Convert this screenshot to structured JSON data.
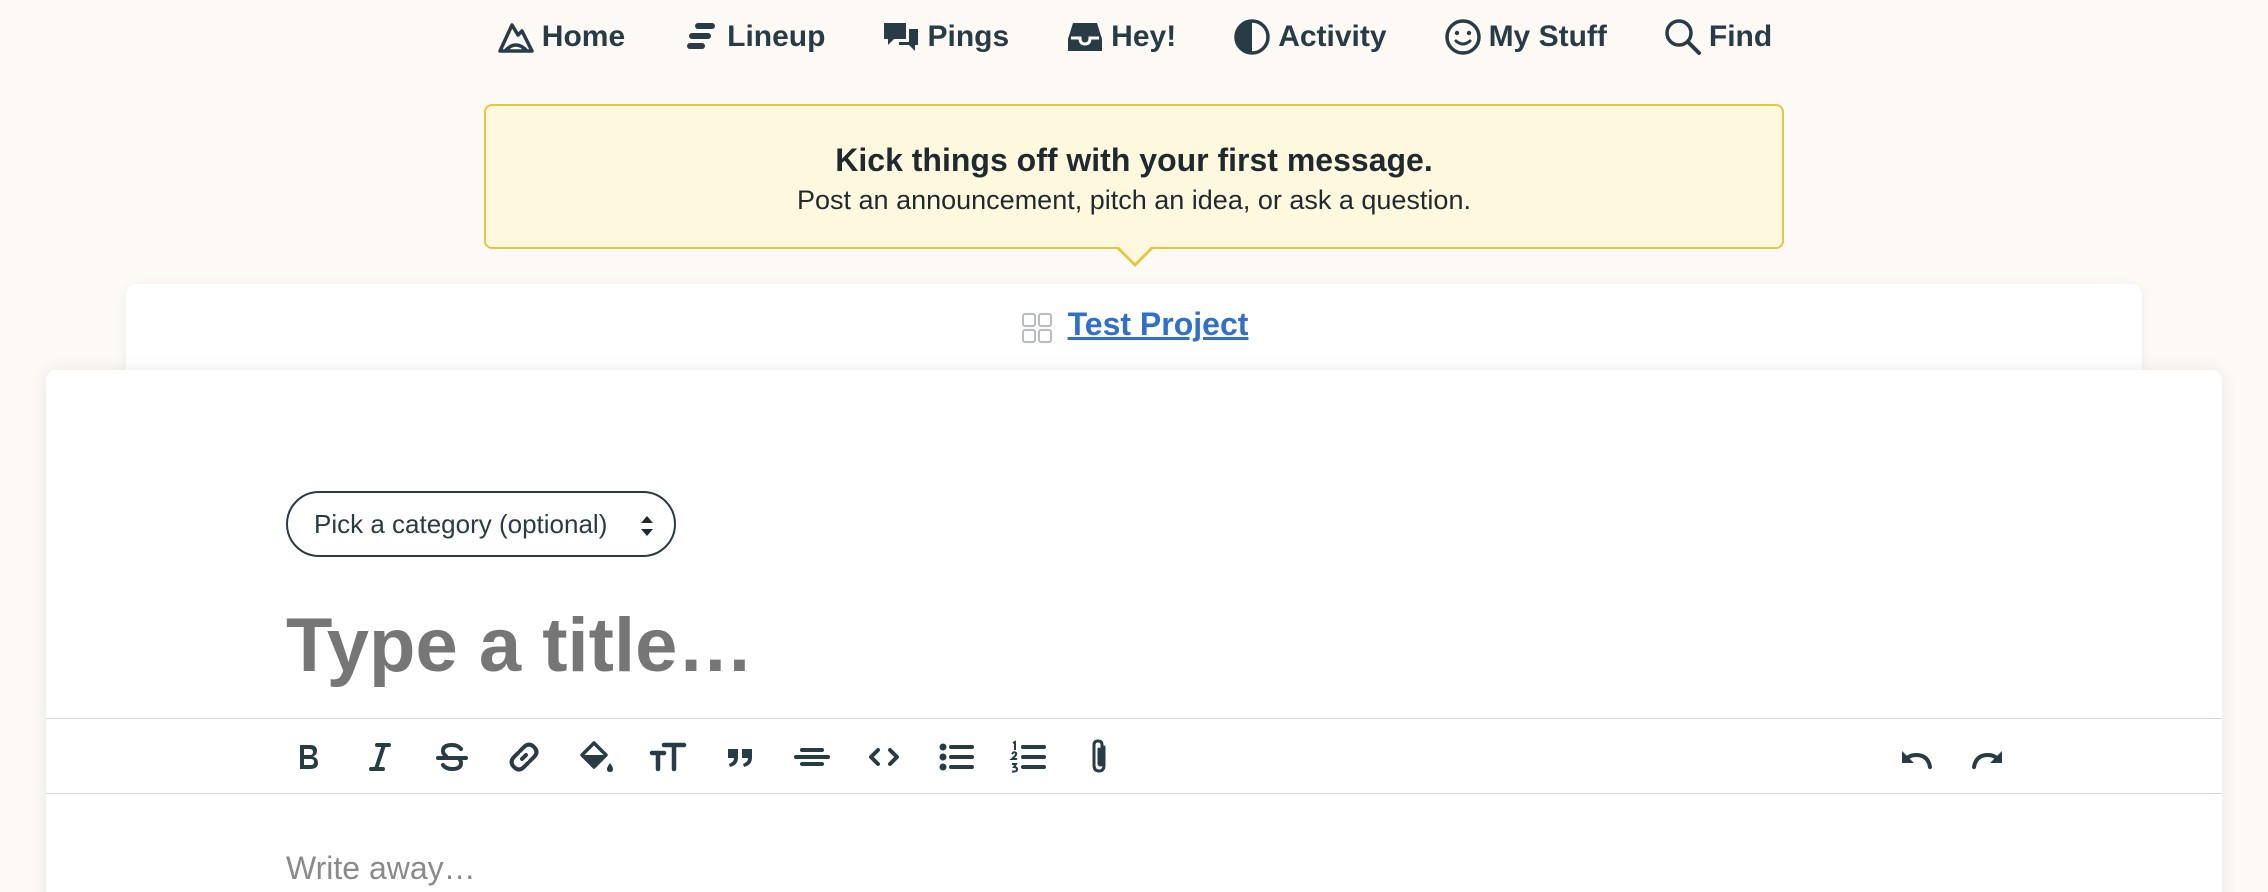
{
  "nav": {
    "items": [
      {
        "label": "Home",
        "icon": "basecamp-mountain-icon"
      },
      {
        "label": "Lineup",
        "icon": "lineup-icon"
      },
      {
        "label": "Pings",
        "icon": "chat-bubbles-icon"
      },
      {
        "label": "Hey!",
        "icon": "inbox-tray-icon"
      },
      {
        "label": "Activity",
        "icon": "pie-clock-icon"
      },
      {
        "label": "My Stuff",
        "icon": "smiley-face-icon"
      },
      {
        "label": "Find",
        "icon": "search-icon"
      }
    ]
  },
  "callout": {
    "title": "Kick things off with your first message.",
    "subtitle": "Post an announcement, pitch an idea, or ask a question.",
    "colors": {
      "background": "#fef9de",
      "border": "#e8c53f"
    }
  },
  "project": {
    "name": "Test Project",
    "icon": "project-grid-icon",
    "link_color": "#2e6fcf"
  },
  "composer": {
    "category": {
      "selected": "Pick a category (optional)"
    },
    "title": {
      "placeholder": "Type a title…",
      "value": ""
    },
    "body": {
      "placeholder": "Write away…"
    },
    "toolbar": {
      "tools": [
        {
          "name": "bold",
          "icon": "bold-icon"
        },
        {
          "name": "italic",
          "icon": "italic-icon"
        },
        {
          "name": "strikethrough",
          "icon": "strikethrough-icon"
        },
        {
          "name": "link",
          "icon": "link-icon"
        },
        {
          "name": "color",
          "icon": "paint-bucket-icon"
        },
        {
          "name": "heading",
          "icon": "text-size-icon"
        },
        {
          "name": "quote",
          "icon": "quote-icon"
        },
        {
          "name": "horizontal-rule",
          "icon": "horizontal-rule-icon"
        },
        {
          "name": "code",
          "icon": "code-icon"
        },
        {
          "name": "bullet-list",
          "icon": "bullet-list-icon"
        },
        {
          "name": "numbered-list",
          "icon": "numbered-list-icon"
        },
        {
          "name": "attach",
          "icon": "paperclip-icon"
        },
        {
          "name": "undo",
          "icon": "undo-icon"
        },
        {
          "name": "redo",
          "icon": "redo-icon"
        }
      ]
    }
  }
}
